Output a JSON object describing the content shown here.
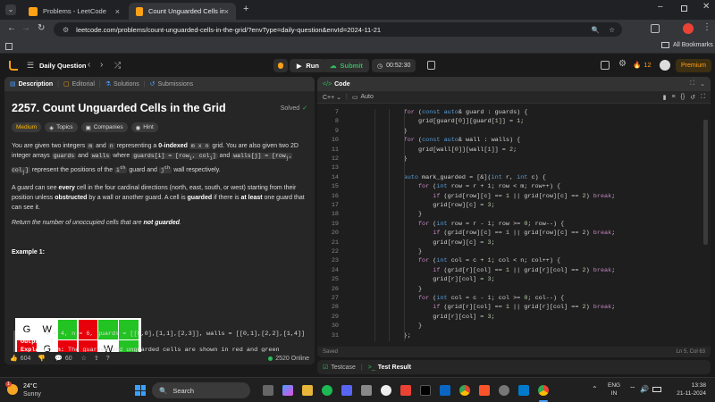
{
  "browser": {
    "tabs": [
      {
        "label": "Problems - LeetCode",
        "close": "×"
      },
      {
        "label": "Count Unguarded Cells in the G",
        "close": "×"
      }
    ],
    "new_tab": "+",
    "url": "leetcode.com/problems/count-unguarded-cells-in-the-grid/?envType=daily-question&envId=2024-11-21",
    "all_bookmarks": "All Bookmarks"
  },
  "lc_header": {
    "daily_question": "Daily Question",
    "run": "Run",
    "submit": "Submit",
    "timer": "00:52:30",
    "streak": "12",
    "premium": "Premium"
  },
  "left_tabs": [
    "Description",
    "Editorial",
    "Solutions",
    "Submissions"
  ],
  "problem": {
    "title": "2257. Count Unguarded Cells in the Grid",
    "solved": "Solved",
    "difficulty": "Medium",
    "topics": "Topics",
    "companies": "Companies",
    "hint": "Hint",
    "para1_a": "You are given two integers",
    "m": "m",
    "para1_and": "and",
    "n": "n",
    "para1_b": "representing a",
    "zero_indexed": "0-indexed",
    "mxn": "m x n",
    "para1_c": "grid. You are also given two 2D integer arrays",
    "guards": "guards",
    "walls": "walls",
    "para1_where": "where",
    "guards_i": "guards[i] = [row",
    "col_i": ", col",
    "walls_j": "walls[j] = [row",
    "para1_d": "represent the positions of the",
    "ith": "i",
    "th": "th",
    "para1_e": "guard and",
    "jth": "j",
    "para1_f": "wall respectively.",
    "para2_a": "A guard can see",
    "every": "every",
    "para2_b": "cell in the four cardinal directions (north, east, south, or west) starting from their position unless",
    "obstructed": "obstructed",
    "para2_c": "by a wall or another guard. A cell is",
    "guarded": "guarded",
    "para2_d": "if there is",
    "at_least": "at least",
    "para2_e": "one guard that can see it.",
    "para3_a": "Return the number of unoccupied cells that are",
    "not_guarded": "not guarded",
    "example_heading": "Example 1:",
    "input_label": "Input:",
    "input_value": "m = 4, n = 6, guards = [[0,0],[1,1],[2,3]], walls = [[0,1],[2,2],[1,4]]",
    "output_label": "Output:",
    "output_value": "7",
    "explanation_label": "Explanation:",
    "explanation_value": "The guarded and unguarded cells are shown in red and green"
  },
  "left_footer": {
    "likes": "604",
    "comments": "60",
    "online": "2520 Online"
  },
  "code_panel": {
    "title": "Code",
    "language": "C++",
    "auto": "Auto",
    "saved": "Saved",
    "cursor": "Ln 5, Col 63",
    "lines": [
      {
        "n": "7",
        "code": "        for (const auto& guard : guards) {"
      },
      {
        "n": "8",
        "code": "            grid[guard[0]][guard[1]] = 1;"
      },
      {
        "n": "9",
        "code": "        }"
      },
      {
        "n": "10",
        "code": "        for (const auto& wall : walls) {"
      },
      {
        "n": "11",
        "code": "            grid[wall[0]][wall[1]] = 2;"
      },
      {
        "n": "12",
        "code": "        }"
      },
      {
        "n": "13",
        "code": ""
      },
      {
        "n": "14",
        "code": "        auto mark_guarded = [&](int r, int c) {"
      },
      {
        "n": "15",
        "code": "            for (int row = r + 1; row < m; row++) {"
      },
      {
        "n": "16",
        "code": "                if (grid[row][c] == 1 || grid[row][c] == 2) break;"
      },
      {
        "n": "17",
        "code": "                grid[row][c] = 3;"
      },
      {
        "n": "18",
        "code": "            }"
      },
      {
        "n": "19",
        "code": "            for (int row = r - 1; row >= 0; row--) {"
      },
      {
        "n": "20",
        "code": "                if (grid[row][c] == 1 || grid[row][c] == 2) break;"
      },
      {
        "n": "21",
        "code": "                grid[row][c] = 3;"
      },
      {
        "n": "22",
        "code": "            }"
      },
      {
        "n": "23",
        "code": "            for (int col = c + 1; col < n; col++) {"
      },
      {
        "n": "24",
        "code": "                if (grid[r][col] == 1 || grid[r][col] == 2) break;"
      },
      {
        "n": "25",
        "code": "                grid[r][col] = 3;"
      },
      {
        "n": "26",
        "code": "            }"
      },
      {
        "n": "27",
        "code": "            for (int col = c - 1; col >= 0; col--) {"
      },
      {
        "n": "28",
        "code": "                if (grid[r][col] == 1 || grid[r][col] == 2) break;"
      },
      {
        "n": "29",
        "code": "                grid[r][col] = 3;"
      },
      {
        "n": "30",
        "code": "            }"
      },
      {
        "n": "31",
        "code": "        };"
      }
    ]
  },
  "bottom_tabs": {
    "testcase": "Testcase",
    "test_result": "Test Result"
  },
  "grid_example": {
    "cells": [
      [
        "G",
        "W",
        "",
        "",
        "",
        ""
      ],
      [
        "",
        "G",
        "",
        "",
        "W",
        ""
      ],
      [
        "",
        "",
        "W",
        "G",
        "",
        ""
      ],
      [
        "",
        "",
        "",
        "",
        "",
        ""
      ]
    ],
    "colors": {
      "guarded": "#e8000b",
      "unguarded": "#22c322",
      "occupied": "#ffffff"
    }
  },
  "taskbar": {
    "temp": "24°C",
    "weather": "Sunny",
    "search": "Search",
    "lang1": "ENG",
    "lang2": "IN",
    "time": "13:38",
    "date": "21-11-2024",
    "weather_badge": "1"
  }
}
